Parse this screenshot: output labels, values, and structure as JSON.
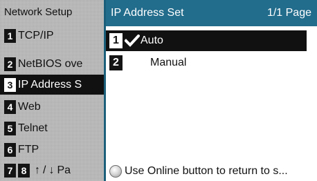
{
  "left_menu": {
    "title": "Network Setup",
    "items": [
      {
        "num": "1",
        "label": "TCP/IP",
        "selected": false
      },
      {
        "num": "2",
        "label": "NetBIOS ove",
        "selected": false
      },
      {
        "num": "3",
        "label": "IP Address S",
        "selected": true
      },
      {
        "num": "4",
        "label": "Web",
        "selected": false
      },
      {
        "num": "5",
        "label": "Telnet",
        "selected": false
      },
      {
        "num": "6",
        "label": "FTP",
        "selected": false
      }
    ],
    "footer": {
      "num_a": "7",
      "num_b": "8",
      "up_arrow": "↑",
      "sep": "/",
      "down_arrow": "↓",
      "label": "Pa"
    }
  },
  "right_panel": {
    "title": "IP Address Set",
    "page_indicator": "1/1 Page",
    "options": [
      {
        "num": "1",
        "label": "Auto",
        "checked": true,
        "selected": true
      },
      {
        "num": "2",
        "label": "Manual",
        "checked": false,
        "selected": false
      }
    ],
    "status_text": "Use Online button to return to s..."
  },
  "colors": {
    "header_blue": "#226c8c",
    "border_blue": "#1b5f7a",
    "selected_bg": "#111111"
  },
  "icons": {
    "check": "checkmark-icon",
    "online": "online-button-icon"
  }
}
